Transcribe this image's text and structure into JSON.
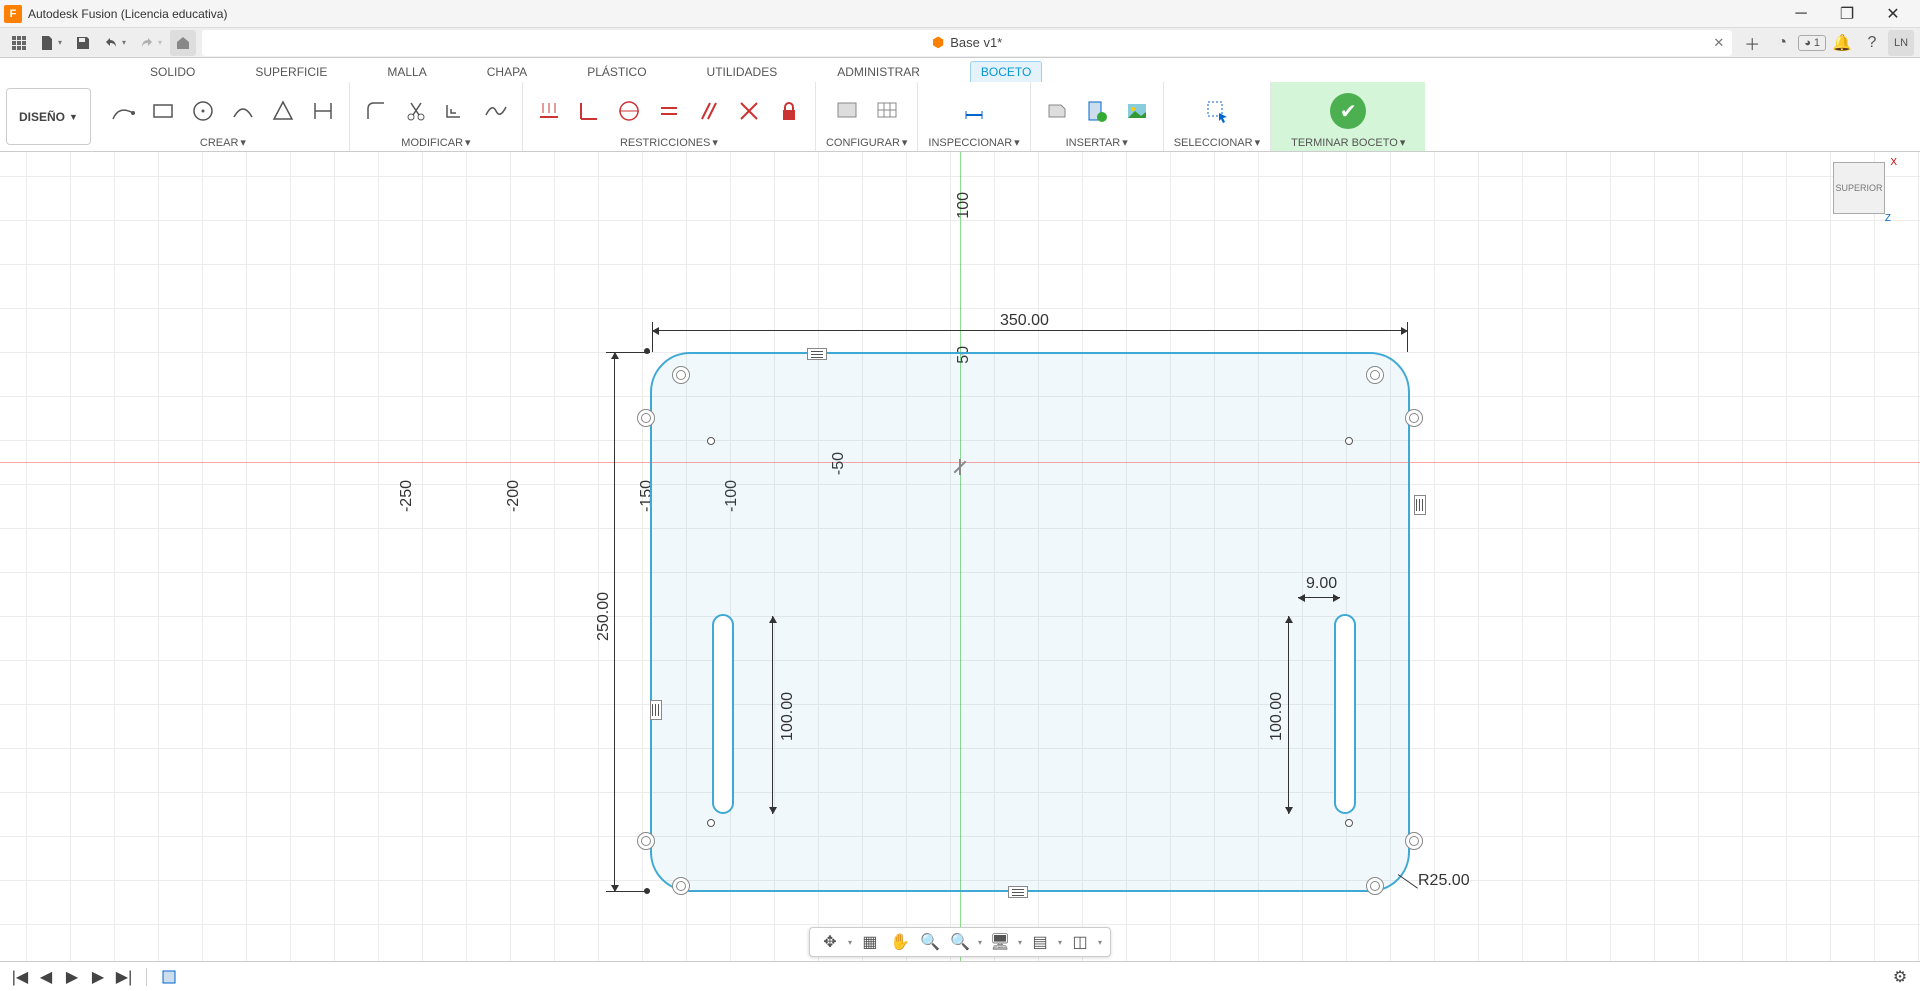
{
  "title": "Autodesk Fusion (Licencia educativa)",
  "document": {
    "name": "Base v1*"
  },
  "jobs": "1",
  "user_initials": "LN",
  "design_button": "DISEÑO",
  "tabs": {
    "solido": "SOLIDO",
    "superficie": "SUPERFICIE",
    "malla": "MALLA",
    "chapa": "CHAPA",
    "plastico": "PLÁSTICO",
    "utilidades": "UTILIDADES",
    "administrar": "ADMINISTRAR",
    "boceto": "BOCETO"
  },
  "panels": {
    "crear": "CREAR",
    "modificar": "MODIFICAR",
    "restricciones": "RESTRICCIONES",
    "configurar": "CONFIGURAR",
    "inspeccionar": "INSPECCIONAR",
    "insertar": "INSERTAR",
    "seleccionar": "SELECCIONAR",
    "terminar": "TERMINAR BOCETO"
  },
  "viewcube": "SUPERIOR",
  "dimensions": {
    "width": "350.00",
    "height": "250.00",
    "slot_height": "100.00",
    "slot_height_r": "100.00",
    "slot_width": "9.00",
    "radius": "R25.00",
    "ruler_100": "100",
    "ruler_50": "50",
    "ruler_m50": "-50",
    "ruler_m100": "-100",
    "ruler_m150": "-150",
    "ruler_m200": "-200",
    "ruler_m250": "-250"
  }
}
